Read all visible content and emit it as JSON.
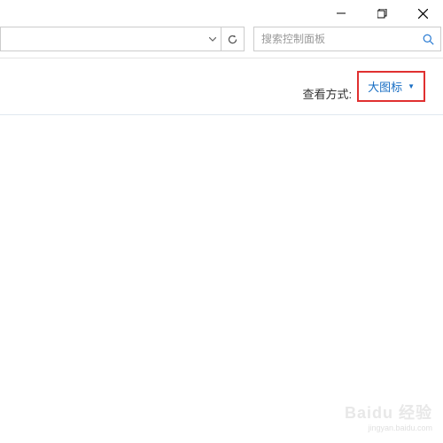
{
  "search": {
    "placeholder": "搜索控制面板"
  },
  "viewMode": {
    "label": "查看方式:",
    "value": "大图标"
  },
  "watermark": {
    "brand": "Baidu 经验",
    "url": "jingyan.baidu.com"
  }
}
